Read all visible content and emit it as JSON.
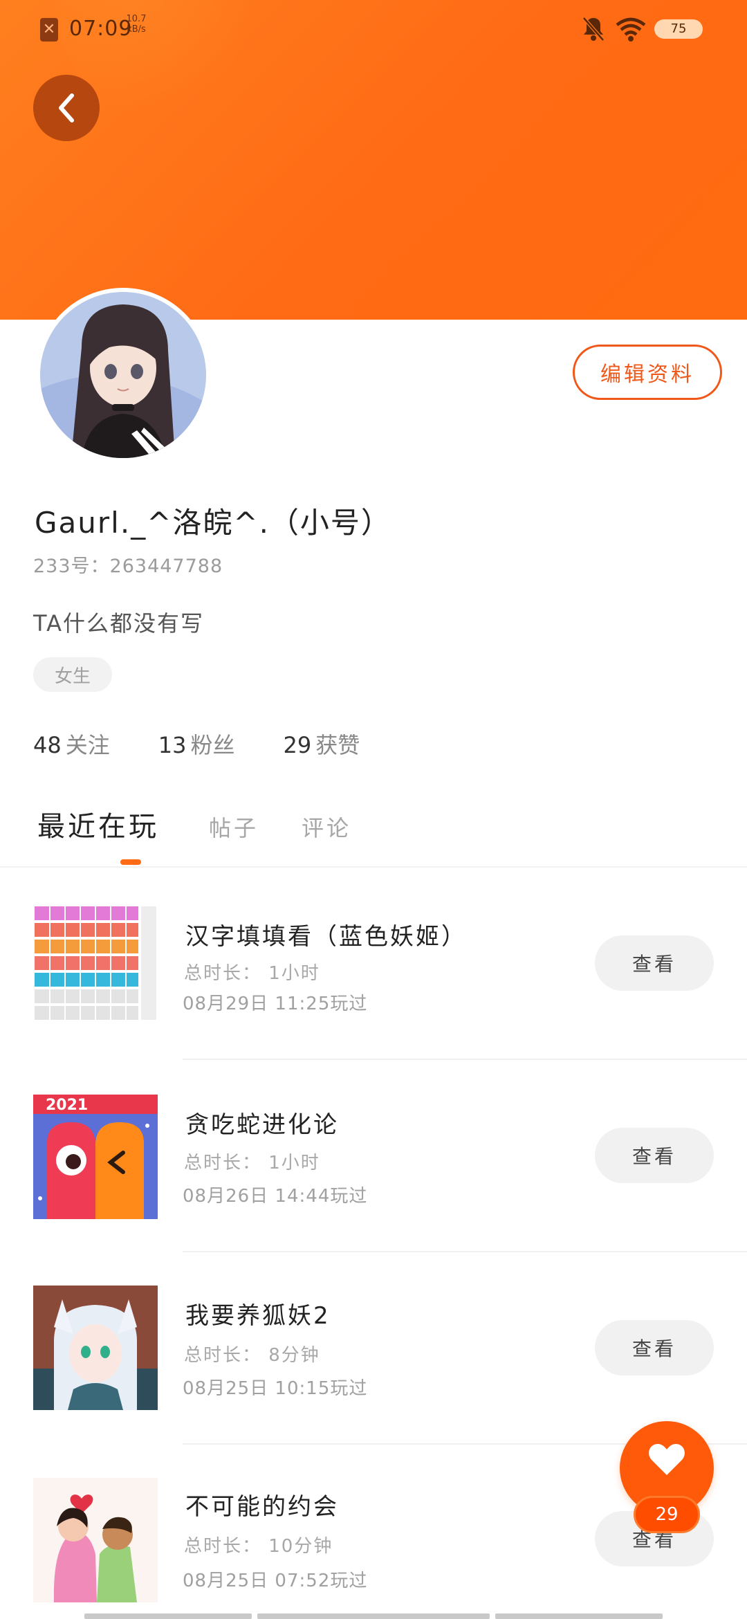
{
  "status_bar": {
    "time": "07:09",
    "net_speed_value": "10.7",
    "net_speed_unit": "kB/s",
    "battery": "75"
  },
  "profile": {
    "edit_button": "编辑资料",
    "username": "Gaurl._^洛皖^.（小号）",
    "user_id": "233号：263447788",
    "bio": "TA什么都没有写",
    "gender": "女生"
  },
  "stats": {
    "following_count": "48",
    "following_label": "关注",
    "followers_count": "13",
    "followers_label": "粉丝",
    "likes_count": "29",
    "likes_label": "获赞"
  },
  "tabs": {
    "recent": "最近在玩",
    "posts": "帖子",
    "comments": "评论"
  },
  "games": [
    {
      "title": "汉字填填看（蓝色妖姬）",
      "duration": "总时长： 1小时",
      "last_played": "08月29日 11:25玩过",
      "button": "查看"
    },
    {
      "title": "贪吃蛇进化论",
      "duration": "总时长： 1小时",
      "last_played": "08月26日 14:44玩过",
      "button": "查看"
    },
    {
      "title": "我要养狐妖2",
      "duration": "总时长： 8分钟",
      "last_played": "08月25日 10:15玩过",
      "button": "查看"
    },
    {
      "title": "不可能的约会",
      "duration": "总时长： 10分钟",
      "last_played": "08月25日 07:52玩过",
      "button": "查看"
    }
  ],
  "like_fab": {
    "count": "29"
  },
  "colors": {
    "accent": "#ff6a14",
    "header": "#ff7a1a"
  }
}
